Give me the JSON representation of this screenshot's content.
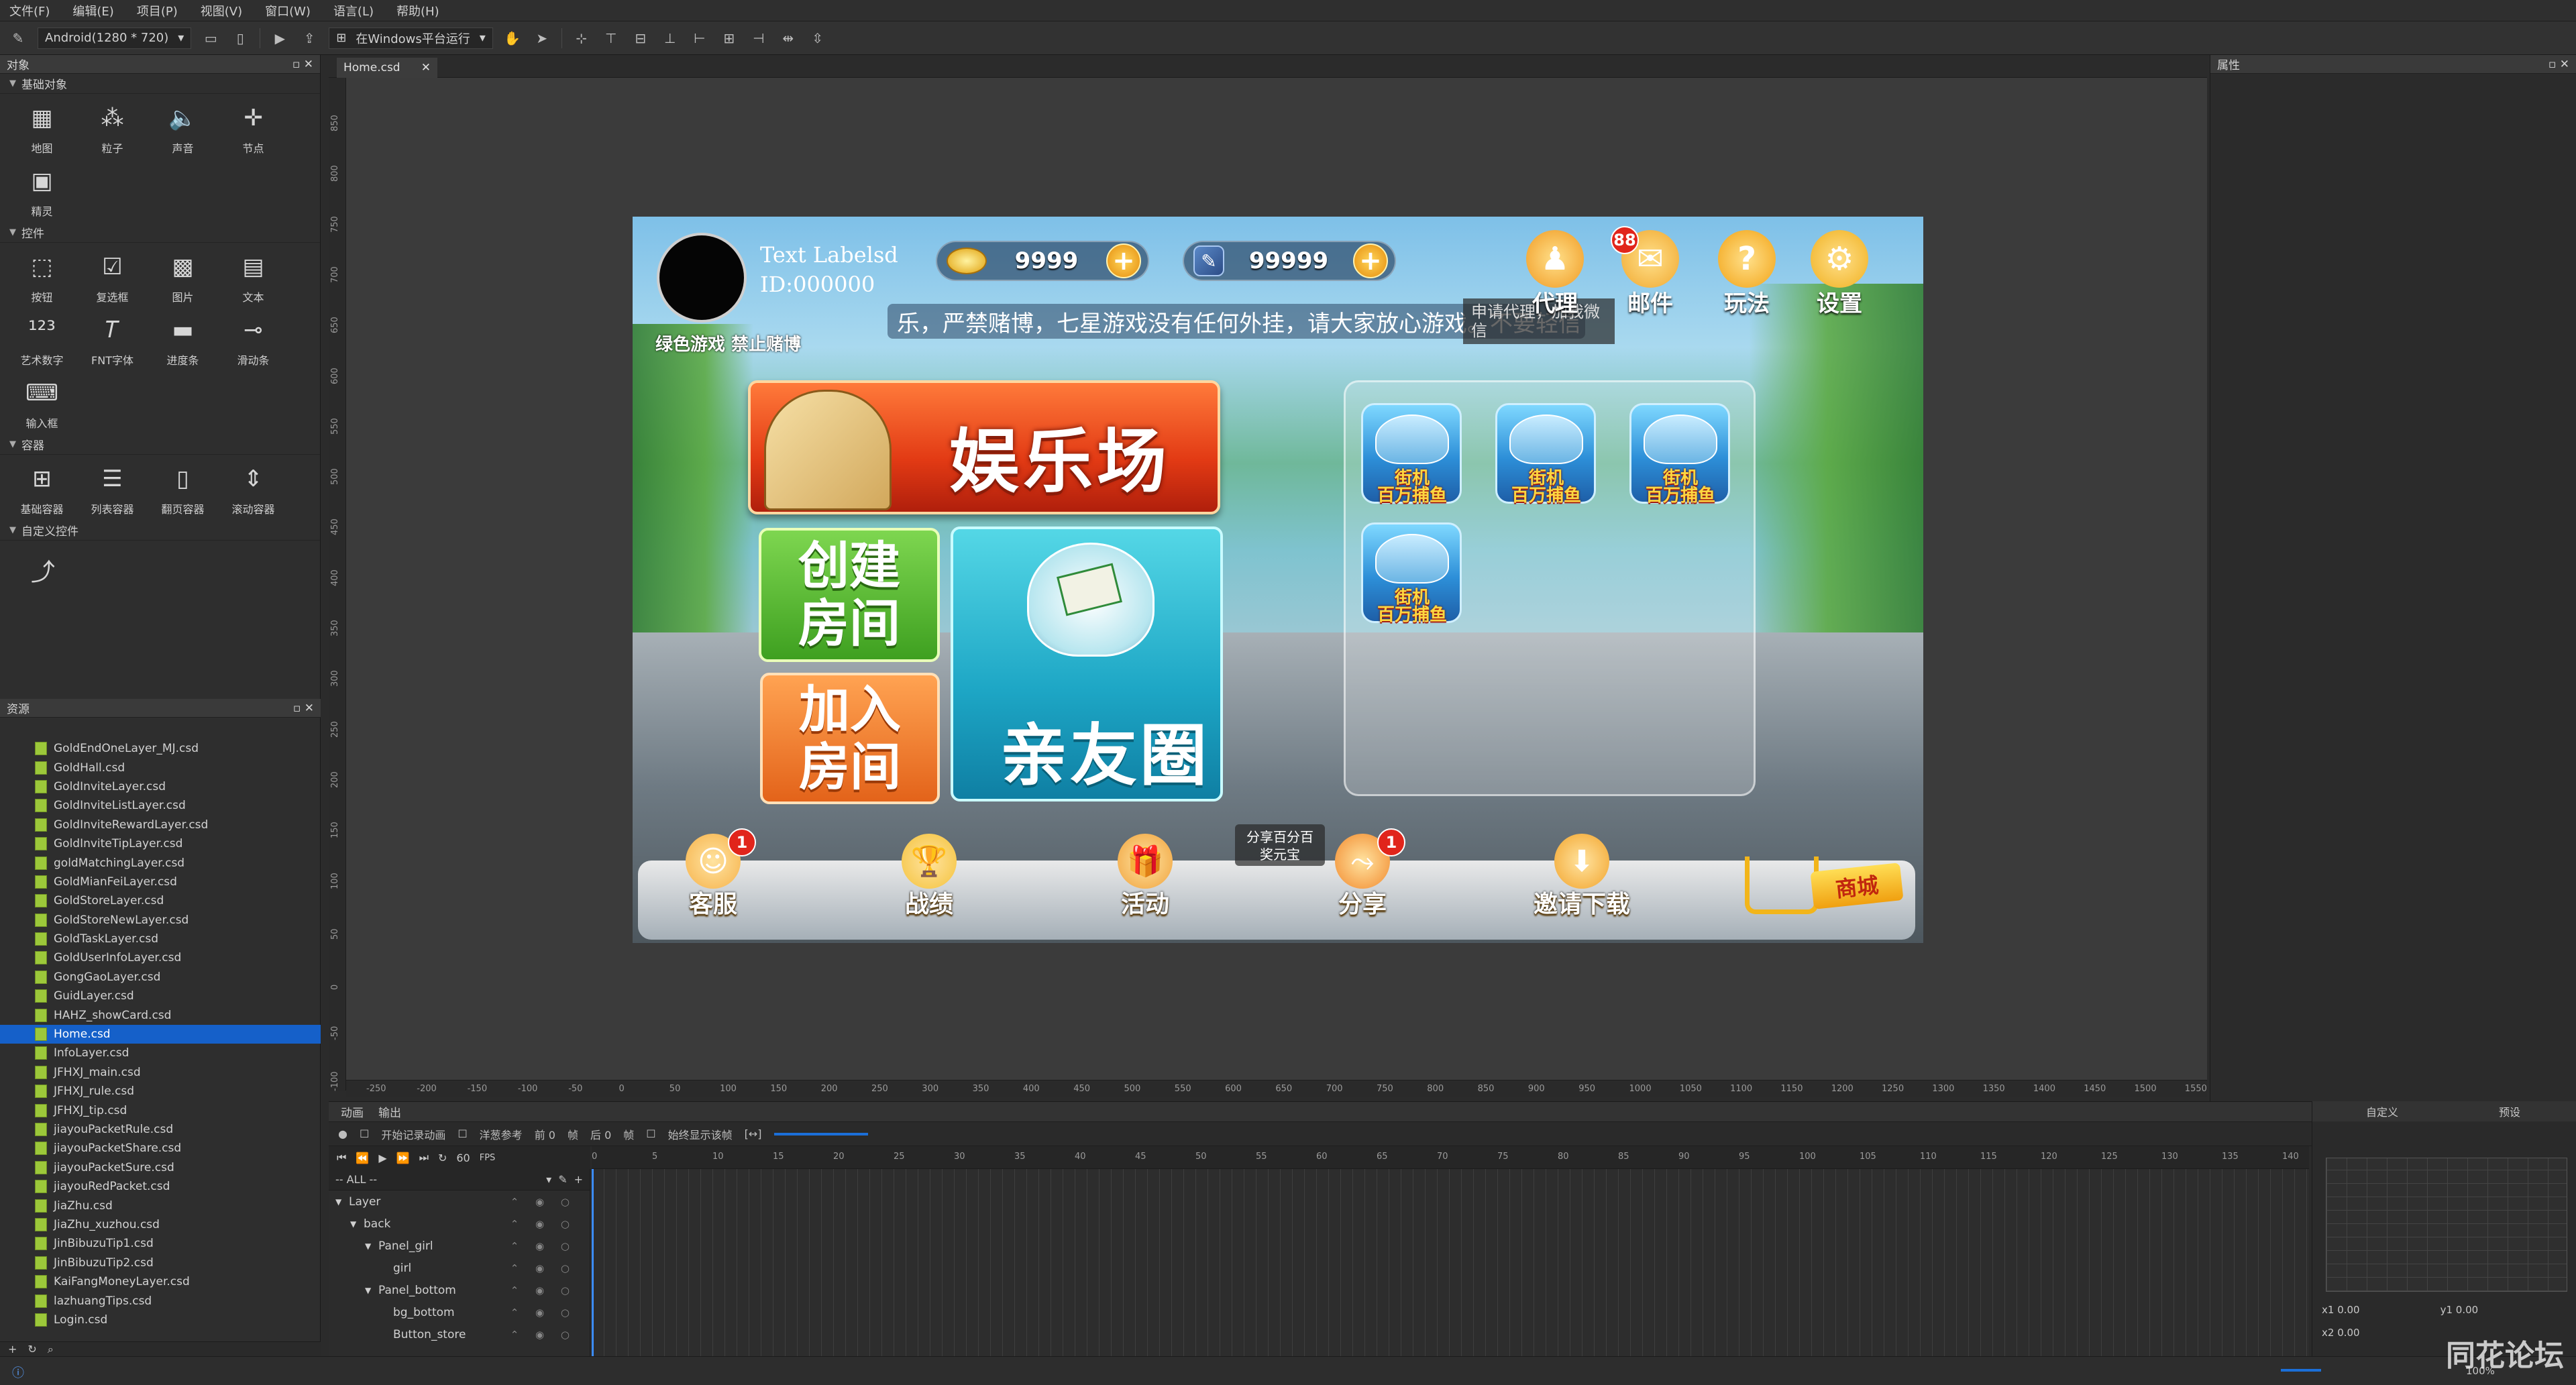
{
  "menubar": [
    "文件(F)",
    "编辑(E)",
    "项目(P)",
    "视图(V)",
    "窗口(W)",
    "语言(L)",
    "帮助(H)"
  ],
  "toolbar": {
    "resolution": "Android(1280 * 720)",
    "run_label": "在Windows平台运行"
  },
  "objects_panel": {
    "title": "对象",
    "basic_section": "基础对象",
    "basic_items": [
      {
        "label": "地图",
        "icon": "map-icon"
      },
      {
        "label": "粒子",
        "icon": "particle-icon"
      },
      {
        "label": "声音",
        "icon": "sound-icon"
      },
      {
        "label": "节点",
        "icon": "node-icon"
      },
      {
        "label": "精灵",
        "icon": "sprite-icon"
      }
    ],
    "controls_section": "控件",
    "control_items": [
      {
        "label": "按钮",
        "icon": "button-icon"
      },
      {
        "label": "复选框",
        "icon": "checkbox-icon"
      },
      {
        "label": "图片",
        "icon": "image-icon"
      },
      {
        "label": "文本",
        "icon": "text-icon"
      },
      {
        "label": "艺术数字",
        "icon": "artnum-icon"
      },
      {
        "label": "FNT字体",
        "icon": "fnt-icon"
      },
      {
        "label": "进度条",
        "icon": "progress-icon"
      },
      {
        "label": "滑动条",
        "icon": "slider-icon"
      },
      {
        "label": "输入框",
        "icon": "textfield-icon"
      }
    ],
    "containers_section": "容器",
    "container_items": [
      {
        "label": "基础容器",
        "icon": "panel-icon"
      },
      {
        "label": "列表容器",
        "icon": "listview-icon"
      },
      {
        "label": "翻页容器",
        "icon": "pageview-icon"
      },
      {
        "label": "滚动容器",
        "icon": "scrollview-icon"
      }
    ],
    "custom_section": "自定义控件"
  },
  "resources_panel": {
    "title": "资源",
    "files": [
      "GoldEndOneLayer_MJ.csd",
      "GoldHall.csd",
      "GoldInviteLayer.csd",
      "GoldInviteListLayer.csd",
      "GoldInviteRewardLayer.csd",
      "GoldInviteTipLayer.csd",
      "goldMatchingLayer.csd",
      "GoldMianFeiLayer.csd",
      "GoldStoreLayer.csd",
      "GoldStoreNewLayer.csd",
      "GoldTaskLayer.csd",
      "GoldUserInfoLayer.csd",
      "GongGaoLayer.csd",
      "GuidLayer.csd",
      "HAHZ_showCard.csd",
      "Home.csd",
      "InfoLayer.csd",
      "JFHXJ_main.csd",
      "JFHXJ_rule.csd",
      "JFHXJ_tip.csd",
      "jiayouPacketRule.csd",
      "jiayouPacketShare.csd",
      "jiayouPacketSure.csd",
      "jiayouRedPacket.csd",
      "JiaZhu.csd",
      "JiaZhu_xuzhou.csd",
      "JinBibuzuTip1.csd",
      "JinBibuzuTip2.csd",
      "KaiFangMoneyLayer.csd",
      "lazhuangTips.csd",
      "Login.csd"
    ],
    "selected": "Home.csd"
  },
  "editor": {
    "tab": "Home.csd"
  },
  "rulers": {
    "h": [
      "-250",
      "-200",
      "-150",
      "-100",
      "-50",
      "0",
      "50",
      "100",
      "150",
      "200",
      "250",
      "300",
      "350",
      "400",
      "450",
      "500",
      "550",
      "600",
      "650",
      "700",
      "750",
      "800",
      "850",
      "900",
      "950",
      "1000",
      "1050",
      "1100",
      "1150",
      "1200",
      "1250",
      "1300",
      "1350",
      "1400",
      "1450",
      "1500",
      "1550"
    ],
    "v": [
      "850",
      "800",
      "750",
      "700",
      "650",
      "600",
      "550",
      "500",
      "450",
      "400",
      "350",
      "300",
      "250",
      "200",
      "150",
      "100",
      "50",
      "0",
      "-50",
      "-100"
    ]
  },
  "scene": {
    "name_label": "Text Labelsd",
    "id_label": "ID:000000",
    "green_note": "绿色游戏  禁止赌博",
    "gold": "9999",
    "cards": "99999",
    "marquee": "乐，严禁赌博，七星游戏没有任何外挂，请大家放心游戏。不要轻信",
    "agent_tooltip": [
      "申请代理，加我微信",
      ""
    ],
    "top_icons": [
      {
        "label": "代理",
        "icon": "agent-icon",
        "badge": ""
      },
      {
        "label": "邮件",
        "icon": "mail-icon",
        "badge": "88"
      },
      {
        "label": "玩法",
        "icon": "help-icon",
        "badge": ""
      },
      {
        "label": "设置",
        "icon": "settings-icon",
        "badge": ""
      }
    ],
    "yule_title": "娱乐场",
    "create_room": "创建\n房间",
    "join_room": "加入\n房间",
    "friends": "亲友圈",
    "game_title": "街机\n百万捕鱼",
    "share_tip": "分享百分百\n奖元宝",
    "bottom_items": [
      {
        "label": "客服",
        "icon": "service-icon",
        "badge": "1"
      },
      {
        "label": "战绩",
        "icon": "trophy-icon",
        "badge": ""
      },
      {
        "label": "活动",
        "icon": "gift-icon",
        "badge": ""
      },
      {
        "label": "分享",
        "icon": "share-icon",
        "badge": "1"
      },
      {
        "label": "邀请下载",
        "icon": "download-icon",
        "badge": ""
      }
    ],
    "shop": "商城"
  },
  "properties_panel": {
    "title": "属性"
  },
  "timeline": {
    "tabs": [
      "动画",
      "输出"
    ],
    "record_label": "开始记录动画",
    "onion_label": "洋葱参考",
    "onion_before": "前 0",
    "frame_label": "帧",
    "onion_after": "后 0",
    "frame_label2": "帧",
    "loop_label": "始终显示该帧",
    "fps": "60",
    "fps_unit": "FPS",
    "filter": "-- ALL --",
    "frame_marks": [
      "0",
      "5",
      "10",
      "15",
      "20",
      "25",
      "30",
      "35",
      "40",
      "45",
      "50",
      "55",
      "60",
      "65",
      "70",
      "75",
      "80",
      "85",
      "90",
      "95",
      "100",
      "105",
      "110",
      "115",
      "120",
      "125",
      "130",
      "135",
      "140"
    ],
    "layers": [
      {
        "label": "Layer",
        "indent": 0,
        "arrow": "▼"
      },
      {
        "label": "back",
        "indent": 1,
        "arrow": "▼"
      },
      {
        "label": "Panel_girl",
        "indent": 2,
        "arrow": "▼"
      },
      {
        "label": "girl",
        "indent": 3,
        "arrow": ""
      },
      {
        "label": "Panel_bottom",
        "indent": 2,
        "arrow": "▼"
      },
      {
        "label": "bg_bottom",
        "indent": 3,
        "arrow": ""
      },
      {
        "label": "Button_store",
        "indent": 3,
        "arrow": ""
      }
    ]
  },
  "curve_panel": {
    "tab_custom": "自定义",
    "tab_preset": "预设",
    "x1": "x1  0.00",
    "y1": "y1  0.00",
    "x2": "x2  0.00"
  },
  "status": {
    "zoom": "100%"
  },
  "watermark": "同花论坛"
}
